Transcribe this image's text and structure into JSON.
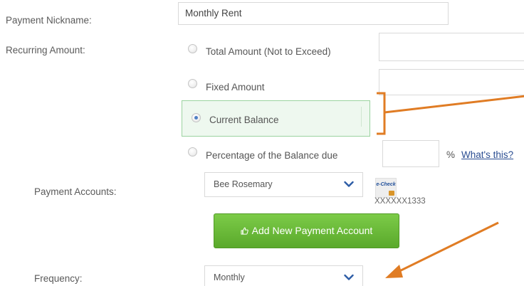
{
  "form": {
    "nickname_label": "Payment Nickname:",
    "nickname_value": "Monthly Rent",
    "recurring_label": "Recurring Amount:",
    "options": [
      {
        "label": "Total Amount (Not to Exceed)",
        "selected": false
      },
      {
        "label": "Fixed Amount",
        "selected": false
      },
      {
        "label": "Current Balance",
        "selected": true
      },
      {
        "label": "Percentage of the Balance due",
        "selected": false
      }
    ],
    "percent_suffix": "%",
    "whats_this": "What's this?",
    "payment_accounts_label": "Payment Accounts:",
    "payment_account_value": "Bee Rosemary",
    "echeck_label": "e-Check",
    "account_number": "XXXXXX1333",
    "add_account_button": "Add New Payment Account",
    "frequency_label": "Frequency:",
    "frequency_value": "Monthly"
  },
  "colors": {
    "accent_green": "#5aa92b",
    "annotation_orange": "#e07c24",
    "link_blue": "#2a4d92",
    "selected_row_bg": "#eef8ef"
  },
  "icons": {
    "add_button_icon": "thumbs-up-icon",
    "dropdown_icon": "chevron-down-icon",
    "payment_method_icon": "echeck-icon"
  }
}
